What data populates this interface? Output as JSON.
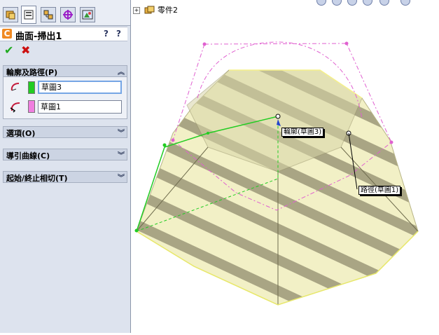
{
  "feature": {
    "title": "曲面-掃出1",
    "icon_letter": "C",
    "help_label": "?",
    "help_label2": "?"
  },
  "actions": {
    "ok": "✔",
    "cancel": "✖"
  },
  "groups": {
    "profile_path": {
      "label": "輪廓及路徑(P)",
      "expanded": true
    },
    "options": {
      "label": "選項(O)",
      "expanded": false
    },
    "guide_curves": {
      "label": "導引曲線(C)",
      "expanded": false
    },
    "tangency": {
      "label": "起始/終止相切(T)",
      "expanded": false
    }
  },
  "selections": {
    "profile": {
      "value": "草圖3",
      "color": "#22cc22"
    },
    "path": {
      "value": "草圖1",
      "color": "#f07ee0"
    }
  },
  "tree": {
    "root_label": "零件2"
  },
  "callouts": {
    "profile": "輪廓(草圖3)",
    "path": "路徑(草圖1)"
  },
  "icons": {
    "tabs": [
      "feature-manager-icon",
      "property-manager-icon",
      "configuration-manager-icon",
      "dimxpert-icon",
      "display-manager-icon"
    ],
    "toolbar": [
      "zoom-to-fit-icon",
      "zoom-area-icon",
      "previous-view-icon",
      "section-view-icon",
      "view-orientation-icon",
      "display-style-icon"
    ]
  }
}
